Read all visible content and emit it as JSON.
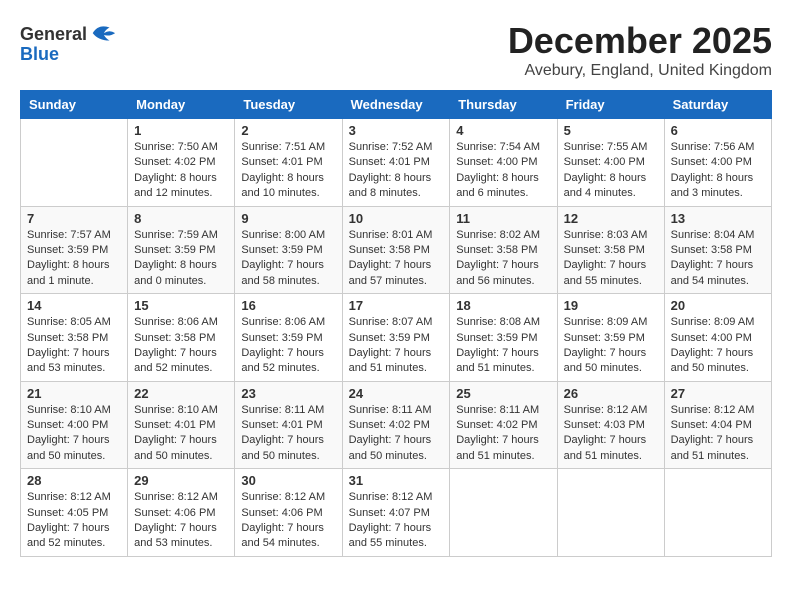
{
  "header": {
    "logo": {
      "line1": "General",
      "line2": "Blue"
    },
    "month": "December 2025",
    "location": "Avebury, England, United Kingdom"
  },
  "weekdays": [
    "Sunday",
    "Monday",
    "Tuesday",
    "Wednesday",
    "Thursday",
    "Friday",
    "Saturday"
  ],
  "weeks": [
    [
      {
        "day": "",
        "info": ""
      },
      {
        "day": "1",
        "info": "Sunrise: 7:50 AM\nSunset: 4:02 PM\nDaylight: 8 hours\nand 12 minutes."
      },
      {
        "day": "2",
        "info": "Sunrise: 7:51 AM\nSunset: 4:01 PM\nDaylight: 8 hours\nand 10 minutes."
      },
      {
        "day": "3",
        "info": "Sunrise: 7:52 AM\nSunset: 4:01 PM\nDaylight: 8 hours\nand 8 minutes."
      },
      {
        "day": "4",
        "info": "Sunrise: 7:54 AM\nSunset: 4:00 PM\nDaylight: 8 hours\nand 6 minutes."
      },
      {
        "day": "5",
        "info": "Sunrise: 7:55 AM\nSunset: 4:00 PM\nDaylight: 8 hours\nand 4 minutes."
      },
      {
        "day": "6",
        "info": "Sunrise: 7:56 AM\nSunset: 4:00 PM\nDaylight: 8 hours\nand 3 minutes."
      }
    ],
    [
      {
        "day": "7",
        "info": "Sunrise: 7:57 AM\nSunset: 3:59 PM\nDaylight: 8 hours\nand 1 minute."
      },
      {
        "day": "8",
        "info": "Sunrise: 7:59 AM\nSunset: 3:59 PM\nDaylight: 8 hours\nand 0 minutes."
      },
      {
        "day": "9",
        "info": "Sunrise: 8:00 AM\nSunset: 3:59 PM\nDaylight: 7 hours\nand 58 minutes."
      },
      {
        "day": "10",
        "info": "Sunrise: 8:01 AM\nSunset: 3:58 PM\nDaylight: 7 hours\nand 57 minutes."
      },
      {
        "day": "11",
        "info": "Sunrise: 8:02 AM\nSunset: 3:58 PM\nDaylight: 7 hours\nand 56 minutes."
      },
      {
        "day": "12",
        "info": "Sunrise: 8:03 AM\nSunset: 3:58 PM\nDaylight: 7 hours\nand 55 minutes."
      },
      {
        "day": "13",
        "info": "Sunrise: 8:04 AM\nSunset: 3:58 PM\nDaylight: 7 hours\nand 54 minutes."
      }
    ],
    [
      {
        "day": "14",
        "info": "Sunrise: 8:05 AM\nSunset: 3:58 PM\nDaylight: 7 hours\nand 53 minutes."
      },
      {
        "day": "15",
        "info": "Sunrise: 8:06 AM\nSunset: 3:58 PM\nDaylight: 7 hours\nand 52 minutes."
      },
      {
        "day": "16",
        "info": "Sunrise: 8:06 AM\nSunset: 3:59 PM\nDaylight: 7 hours\nand 52 minutes."
      },
      {
        "day": "17",
        "info": "Sunrise: 8:07 AM\nSunset: 3:59 PM\nDaylight: 7 hours\nand 51 minutes."
      },
      {
        "day": "18",
        "info": "Sunrise: 8:08 AM\nSunset: 3:59 PM\nDaylight: 7 hours\nand 51 minutes."
      },
      {
        "day": "19",
        "info": "Sunrise: 8:09 AM\nSunset: 3:59 PM\nDaylight: 7 hours\nand 50 minutes."
      },
      {
        "day": "20",
        "info": "Sunrise: 8:09 AM\nSunset: 4:00 PM\nDaylight: 7 hours\nand 50 minutes."
      }
    ],
    [
      {
        "day": "21",
        "info": "Sunrise: 8:10 AM\nSunset: 4:00 PM\nDaylight: 7 hours\nand 50 minutes."
      },
      {
        "day": "22",
        "info": "Sunrise: 8:10 AM\nSunset: 4:01 PM\nDaylight: 7 hours\nand 50 minutes."
      },
      {
        "day": "23",
        "info": "Sunrise: 8:11 AM\nSunset: 4:01 PM\nDaylight: 7 hours\nand 50 minutes."
      },
      {
        "day": "24",
        "info": "Sunrise: 8:11 AM\nSunset: 4:02 PM\nDaylight: 7 hours\nand 50 minutes."
      },
      {
        "day": "25",
        "info": "Sunrise: 8:11 AM\nSunset: 4:02 PM\nDaylight: 7 hours\nand 51 minutes."
      },
      {
        "day": "26",
        "info": "Sunrise: 8:12 AM\nSunset: 4:03 PM\nDaylight: 7 hours\nand 51 minutes."
      },
      {
        "day": "27",
        "info": "Sunrise: 8:12 AM\nSunset: 4:04 PM\nDaylight: 7 hours\nand 51 minutes."
      }
    ],
    [
      {
        "day": "28",
        "info": "Sunrise: 8:12 AM\nSunset: 4:05 PM\nDaylight: 7 hours\nand 52 minutes."
      },
      {
        "day": "29",
        "info": "Sunrise: 8:12 AM\nSunset: 4:06 PM\nDaylight: 7 hours\nand 53 minutes."
      },
      {
        "day": "30",
        "info": "Sunrise: 8:12 AM\nSunset: 4:06 PM\nDaylight: 7 hours\nand 54 minutes."
      },
      {
        "day": "31",
        "info": "Sunrise: 8:12 AM\nSunset: 4:07 PM\nDaylight: 7 hours\nand 55 minutes."
      },
      {
        "day": "",
        "info": ""
      },
      {
        "day": "",
        "info": ""
      },
      {
        "day": "",
        "info": ""
      }
    ]
  ]
}
